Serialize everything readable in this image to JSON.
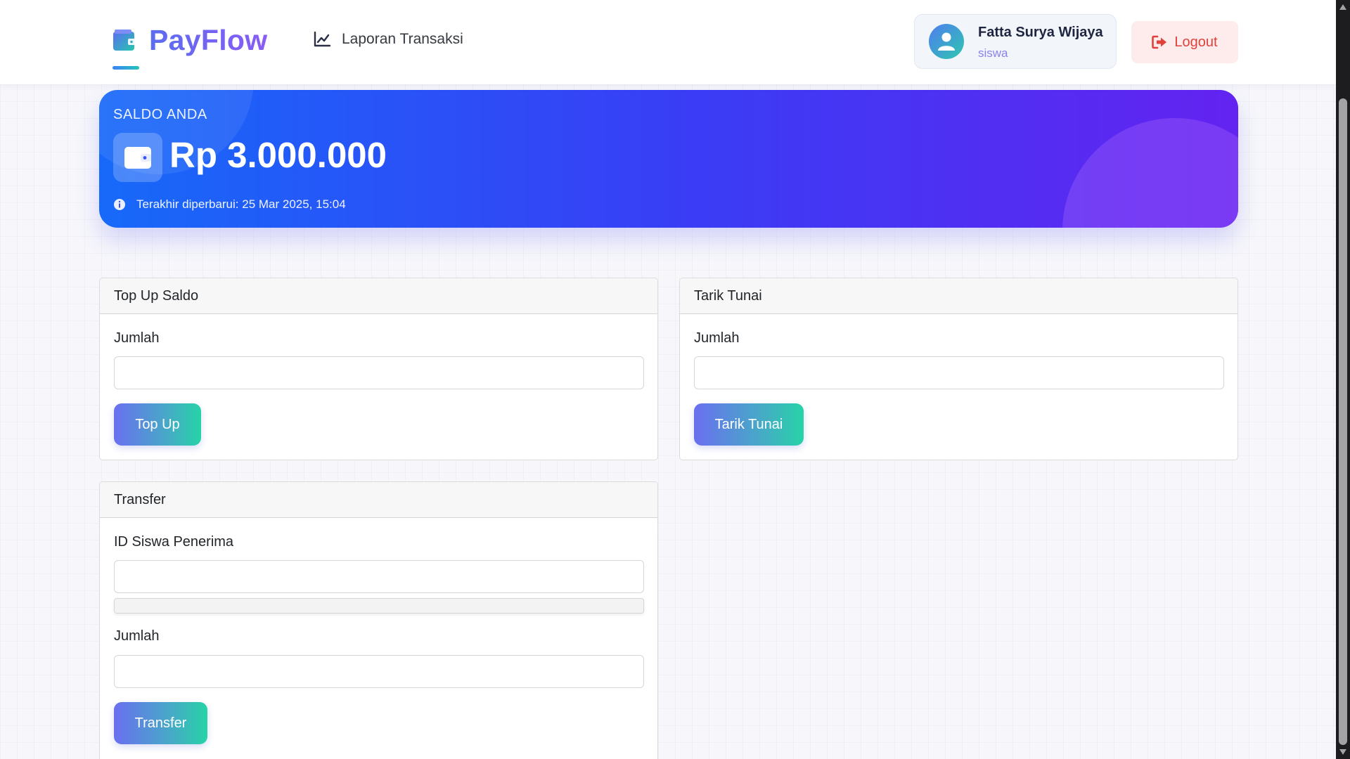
{
  "app": {
    "brand": "PayFlow"
  },
  "nav": {
    "report_link": "Laporan Transaksi"
  },
  "user": {
    "name": "Fatta Surya Wijaya",
    "role": "siswa",
    "logout_label": "Logout"
  },
  "balance": {
    "label": "SALDO ANDA",
    "amount": "Rp 3.000.000",
    "updated": "Terakhir diperbarui: 25 Mar 2025, 15:04"
  },
  "topup": {
    "title": "Top Up Saldo",
    "amount_label": "Jumlah",
    "amount_value": "",
    "button": "Top Up"
  },
  "withdraw": {
    "title": "Tarik Tunai",
    "amount_label": "Jumlah",
    "amount_value": "",
    "button": "Tarik Tunai"
  },
  "transfer": {
    "title": "Transfer",
    "recipient_label": "ID Siswa Penerima",
    "recipient_value": "",
    "amount_label": "Jumlah",
    "amount_value": "",
    "button": "Transfer"
  },
  "colors": {
    "brand_gradient_start": "#5b6df0",
    "brand_gradient_end": "#8a5cf5",
    "balance_gradient_start": "#1769f9",
    "balance_gradient_end": "#6323f0",
    "button_gradient_start": "#6a6ff0",
    "button_gradient_end": "#27d3a8",
    "logout_text": "#e0413b",
    "logout_bg": "#fdeceb"
  },
  "icons": {
    "brand": "wallet-icon",
    "report": "chart-line-icon",
    "avatar": "user-icon",
    "logout": "sign-out-icon",
    "balance": "wallet-icon",
    "info": "info-circle-icon"
  }
}
